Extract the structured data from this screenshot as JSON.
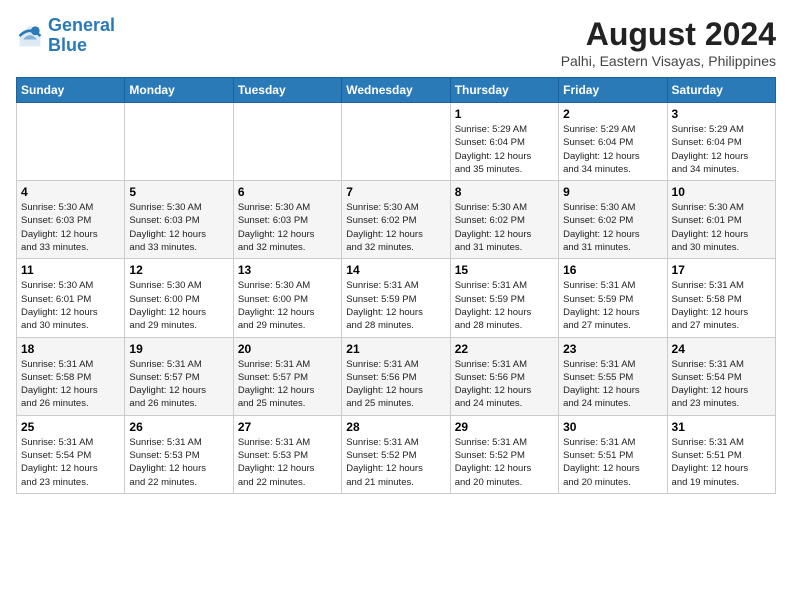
{
  "header": {
    "logo_text_general": "General",
    "logo_text_blue": "Blue",
    "month_year": "August 2024",
    "location": "Palhi, Eastern Visayas, Philippines"
  },
  "days_of_week": [
    "Sunday",
    "Monday",
    "Tuesday",
    "Wednesday",
    "Thursday",
    "Friday",
    "Saturday"
  ],
  "weeks": [
    [
      {
        "day": "",
        "info": ""
      },
      {
        "day": "",
        "info": ""
      },
      {
        "day": "",
        "info": ""
      },
      {
        "day": "",
        "info": ""
      },
      {
        "day": "1",
        "info": "Sunrise: 5:29 AM\nSunset: 6:04 PM\nDaylight: 12 hours\nand 35 minutes."
      },
      {
        "day": "2",
        "info": "Sunrise: 5:29 AM\nSunset: 6:04 PM\nDaylight: 12 hours\nand 34 minutes."
      },
      {
        "day": "3",
        "info": "Sunrise: 5:29 AM\nSunset: 6:04 PM\nDaylight: 12 hours\nand 34 minutes."
      }
    ],
    [
      {
        "day": "4",
        "info": "Sunrise: 5:30 AM\nSunset: 6:03 PM\nDaylight: 12 hours\nand 33 minutes."
      },
      {
        "day": "5",
        "info": "Sunrise: 5:30 AM\nSunset: 6:03 PM\nDaylight: 12 hours\nand 33 minutes."
      },
      {
        "day": "6",
        "info": "Sunrise: 5:30 AM\nSunset: 6:03 PM\nDaylight: 12 hours\nand 32 minutes."
      },
      {
        "day": "7",
        "info": "Sunrise: 5:30 AM\nSunset: 6:02 PM\nDaylight: 12 hours\nand 32 minutes."
      },
      {
        "day": "8",
        "info": "Sunrise: 5:30 AM\nSunset: 6:02 PM\nDaylight: 12 hours\nand 31 minutes."
      },
      {
        "day": "9",
        "info": "Sunrise: 5:30 AM\nSunset: 6:02 PM\nDaylight: 12 hours\nand 31 minutes."
      },
      {
        "day": "10",
        "info": "Sunrise: 5:30 AM\nSunset: 6:01 PM\nDaylight: 12 hours\nand 30 minutes."
      }
    ],
    [
      {
        "day": "11",
        "info": "Sunrise: 5:30 AM\nSunset: 6:01 PM\nDaylight: 12 hours\nand 30 minutes."
      },
      {
        "day": "12",
        "info": "Sunrise: 5:30 AM\nSunset: 6:00 PM\nDaylight: 12 hours\nand 29 minutes."
      },
      {
        "day": "13",
        "info": "Sunrise: 5:30 AM\nSunset: 6:00 PM\nDaylight: 12 hours\nand 29 minutes."
      },
      {
        "day": "14",
        "info": "Sunrise: 5:31 AM\nSunset: 5:59 PM\nDaylight: 12 hours\nand 28 minutes."
      },
      {
        "day": "15",
        "info": "Sunrise: 5:31 AM\nSunset: 5:59 PM\nDaylight: 12 hours\nand 28 minutes."
      },
      {
        "day": "16",
        "info": "Sunrise: 5:31 AM\nSunset: 5:59 PM\nDaylight: 12 hours\nand 27 minutes."
      },
      {
        "day": "17",
        "info": "Sunrise: 5:31 AM\nSunset: 5:58 PM\nDaylight: 12 hours\nand 27 minutes."
      }
    ],
    [
      {
        "day": "18",
        "info": "Sunrise: 5:31 AM\nSunset: 5:58 PM\nDaylight: 12 hours\nand 26 minutes."
      },
      {
        "day": "19",
        "info": "Sunrise: 5:31 AM\nSunset: 5:57 PM\nDaylight: 12 hours\nand 26 minutes."
      },
      {
        "day": "20",
        "info": "Sunrise: 5:31 AM\nSunset: 5:57 PM\nDaylight: 12 hours\nand 25 minutes."
      },
      {
        "day": "21",
        "info": "Sunrise: 5:31 AM\nSunset: 5:56 PM\nDaylight: 12 hours\nand 25 minutes."
      },
      {
        "day": "22",
        "info": "Sunrise: 5:31 AM\nSunset: 5:56 PM\nDaylight: 12 hours\nand 24 minutes."
      },
      {
        "day": "23",
        "info": "Sunrise: 5:31 AM\nSunset: 5:55 PM\nDaylight: 12 hours\nand 24 minutes."
      },
      {
        "day": "24",
        "info": "Sunrise: 5:31 AM\nSunset: 5:54 PM\nDaylight: 12 hours\nand 23 minutes."
      }
    ],
    [
      {
        "day": "25",
        "info": "Sunrise: 5:31 AM\nSunset: 5:54 PM\nDaylight: 12 hours\nand 23 minutes."
      },
      {
        "day": "26",
        "info": "Sunrise: 5:31 AM\nSunset: 5:53 PM\nDaylight: 12 hours\nand 22 minutes."
      },
      {
        "day": "27",
        "info": "Sunrise: 5:31 AM\nSunset: 5:53 PM\nDaylight: 12 hours\nand 22 minutes."
      },
      {
        "day": "28",
        "info": "Sunrise: 5:31 AM\nSunset: 5:52 PM\nDaylight: 12 hours\nand 21 minutes."
      },
      {
        "day": "29",
        "info": "Sunrise: 5:31 AM\nSunset: 5:52 PM\nDaylight: 12 hours\nand 20 minutes."
      },
      {
        "day": "30",
        "info": "Sunrise: 5:31 AM\nSunset: 5:51 PM\nDaylight: 12 hours\nand 20 minutes."
      },
      {
        "day": "31",
        "info": "Sunrise: 5:31 AM\nSunset: 5:51 PM\nDaylight: 12 hours\nand 19 minutes."
      }
    ]
  ]
}
